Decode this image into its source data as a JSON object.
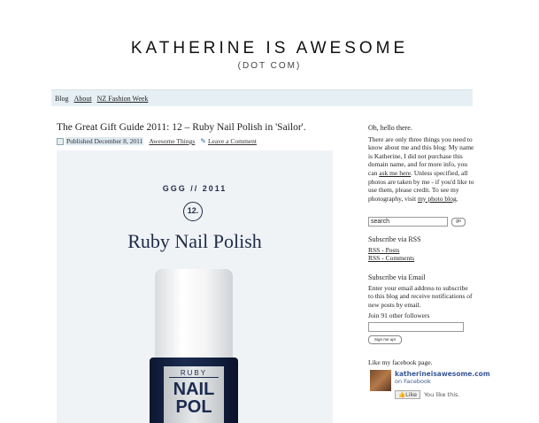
{
  "header": {
    "title": "KATHERINE IS AWESOME",
    "subtitle": "(DOT COM)"
  },
  "nav": {
    "items": [
      "Blog",
      "About",
      "NZ Fashion Week"
    ]
  },
  "post": {
    "title": "The Great Gift Guide 2011: 12 – Ruby Nail Polish in 'Sailor'.",
    "published": "Published December 8, 2011",
    "category": "Awesome Things",
    "comment_link": "Leave a Comment",
    "image": {
      "tag": "GGG // 2011",
      "number": "12.",
      "title": "Ruby Nail Polish",
      "label_brand": "RUBY",
      "label_line1": "NAIL",
      "label_line2": "POL"
    }
  },
  "sidebar": {
    "greeting": "Oh, hello there.",
    "intro_part1": "There are only three things you need to know about me and this blog: My name is Katherine, I did not purchase this domain name, and for more info, you can",
    "intro_link1": "ask me here",
    "intro_part2": ". Unless specified, all photos are taken by me - if you'd like to use them, please credit. To see my photography, visit",
    "intro_link2": "my photo blog",
    "intro_end": ".",
    "search_value": "search",
    "search_button": "go",
    "rss_heading": "Subscribe via RSS",
    "rss_posts": "RSS - Posts",
    "rss_comments": "RSS - Comments",
    "email_heading": "Subscribe via Email",
    "email_text": "Enter your email address to subscribe to this blog and receive notifications of new posts by email.",
    "followers": "Join 91 other followers",
    "signup_button": "Sign me up!",
    "facebook_heading": "Like my facebook page.",
    "facebook_name": "katherineisawesome.com",
    "facebook_on": "on Facebook",
    "like_button": "Like",
    "you_like": "You like this."
  }
}
